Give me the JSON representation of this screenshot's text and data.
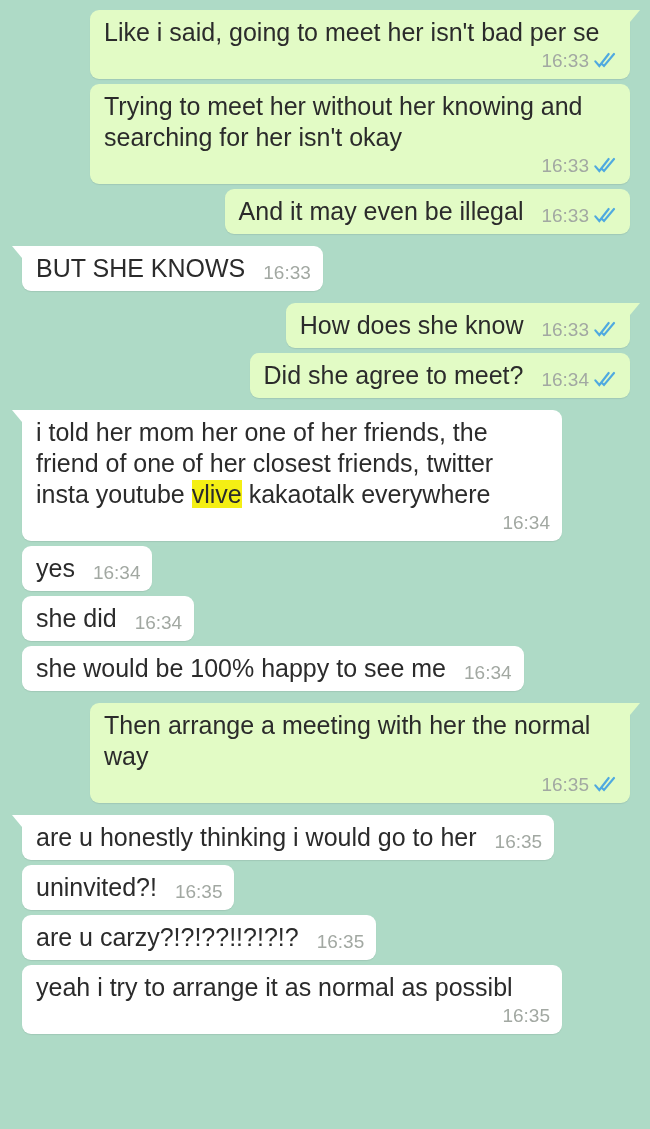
{
  "messages": [
    {
      "kind": "out",
      "segments": [
        {
          "text": "Like i said, going to meet her isn't bad per se",
          "highlighted": false
        }
      ],
      "time": "16:33",
      "read": true
    },
    {
      "kind": "out",
      "segments": [
        {
          "text": "Trying to meet her without her knowing and searching for her isn't okay",
          "highlighted": false
        }
      ],
      "time": "16:33",
      "read": true
    },
    {
      "kind": "out",
      "segments": [
        {
          "text": "And it may even be illegal",
          "highlighted": false
        }
      ],
      "time": "16:33",
      "read": true
    },
    {
      "kind": "in",
      "segments": [
        {
          "text": "BUT SHE KNOWS",
          "highlighted": false
        }
      ],
      "time": "16:33"
    },
    {
      "kind": "out",
      "segments": [
        {
          "text": "How does she know",
          "highlighted": false
        }
      ],
      "time": "16:33",
      "read": true
    },
    {
      "kind": "out",
      "segments": [
        {
          "text": "Did she agree to meet?",
          "highlighted": false
        }
      ],
      "time": "16:34",
      "read": true
    },
    {
      "kind": "in",
      "segments": [
        {
          "text": "i told her mom her one of her friends, the friend of one of her closest friends, twitter insta youtube ",
          "highlighted": false
        },
        {
          "text": "vlive",
          "highlighted": true
        },
        {
          "text": " kakaotalk everywhere",
          "highlighted": false
        }
      ],
      "time": "16:34"
    },
    {
      "kind": "in",
      "segments": [
        {
          "text": "yes",
          "highlighted": false
        }
      ],
      "time": "16:34"
    },
    {
      "kind": "in",
      "segments": [
        {
          "text": "she did",
          "highlighted": false
        }
      ],
      "time": "16:34"
    },
    {
      "kind": "in",
      "segments": [
        {
          "text": "she would be 100% happy to see me",
          "highlighted": false
        }
      ],
      "time": "16:34"
    },
    {
      "kind": "out",
      "segments": [
        {
          "text": "Then arrange a meeting with her the normal way",
          "highlighted": false
        }
      ],
      "time": "16:35",
      "read": true
    },
    {
      "kind": "in",
      "segments": [
        {
          "text": "are u honestly thinking i would go to her",
          "highlighted": false
        }
      ],
      "time": "16:35"
    },
    {
      "kind": "in",
      "segments": [
        {
          "text": "uninvited?!",
          "highlighted": false
        }
      ],
      "time": "16:35"
    },
    {
      "kind": "in",
      "segments": [
        {
          "text": "are u carzy?!?!??!!?!?!?",
          "highlighted": false
        }
      ],
      "time": "16:35"
    },
    {
      "kind": "in",
      "segments": [
        {
          "text": "yeah i try to arrange it as normal as possibl",
          "highlighted": false
        }
      ],
      "time": "16:35"
    }
  ]
}
